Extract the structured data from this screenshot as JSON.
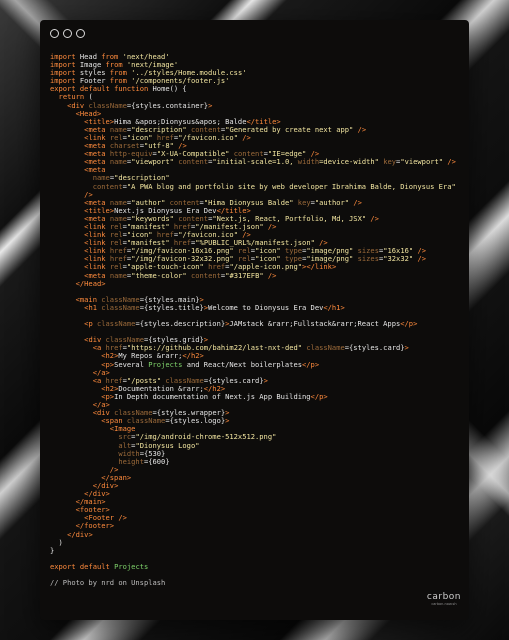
{
  "window": {
    "controls": [
      "close",
      "minimize",
      "maximize"
    ]
  },
  "code": {
    "lines": [
      "import Head from 'next/head'",
      "import Image from 'next/image'",
      "import styles from '../styles/Home.module.css'",
      "import Footer from '/components/footer.js'",
      "export default function Home() {",
      "  return (",
      "    <div className={styles.container}>",
      "      <Head>",
      "        <title>Hima &apos;Dionysus&apos; Balde</title>",
      "        <meta name=\"description\" content=\"Generated by create next app\" />",
      "        <link rel=\"icon\" href=\"/favicon.ico\" />",
      "        <meta charset=\"utf-8\" />",
      "        <meta http-equiv=\"X-UA-Compatible\" content=\"IE=edge\" />",
      "        <meta name=\"viewport\" content=\"initial-scale=1.0, width=device-width\" key=\"viewport\" />",
      "        <meta",
      "          name=\"description\"",
      "          content=\"A PWA blog and portfolio site by web developer Ibrahima Balde, Dionysus Era\"",
      "        />",
      "        <meta name=\"author\" content=\"Hima Dionysus Balde\" key=\"author\" />",
      "        <title>Next.js Dionysus Era Dev</title>",
      "        <meta name=\"keywords\" content=\"Next.js, React, Portfolio, Md, JSX\" />",
      "        <link rel=\"manifest\" href=\"/manifest.json\" />",
      "        <link rel=\"icon\" href=\"/favicon.ico\" />",
      "        <link rel=\"manifest\" href=\"%PUBLIC_URL%/manifest.json\" />",
      "        <link href=\"/img/favicon-16x16.png\" rel=\"icon\" type=\"image/png\" sizes=\"16x16\" />",
      "        <link href=\"/img/favicon-32x32.png\" rel=\"icon\" type=\"image/png\" sizes=\"32x32\" />",
      "        <link rel=\"apple-touch-icon\" href=\"/apple-icon.png\"></link>",
      "        <meta name=\"theme-color\" content=\"#317EFB\" />",
      "      </Head>",
      "",
      "      <main className={styles.main}>",
      "        <h1 className={styles.title}>Welcome to Dionysus Era Dev</h1>",
      "",
      "        <p className={styles.description}>JAMstack &rarr;Fullstack&rarr;React Apps</p>",
      "",
      "        <div className={styles.grid}>",
      "          <a href=\"https://github.com/bahim22/last-nxt-ded\" className={styles.card}>",
      "            <h2>My Repos &rarr;</h2>",
      "            <p>Several Projects and React/Next boilerplates</p>",
      "          </a>",
      "          <a href=\"/posts\" className={styles.card}>",
      "            <h2>Documentation &rarr;</h2>",
      "            <p>In Depth documentation of Next.js App Building</p>",
      "          </a>",
      "          <div className={styles.wrapper}>",
      "            <span className={styles.logo}>",
      "              <Image",
      "                src=\"/img/android-chrome-512x512.png\"",
      "                alt=\"Dionysus Logo\"",
      "                width={530}",
      "                height={600}",
      "              />",
      "            </span>",
      "          </div>",
      "        </div>",
      "      </main>",
      "      <footer>",
      "        <Footer />",
      "      </footer>",
      "    </div>",
      "  )",
      "}",
      "",
      "export default Projects",
      "",
      "// Photo by nrd on Unsplash"
    ]
  },
  "brand": {
    "name": "carbon",
    "sub": "carbon.now.sh"
  }
}
